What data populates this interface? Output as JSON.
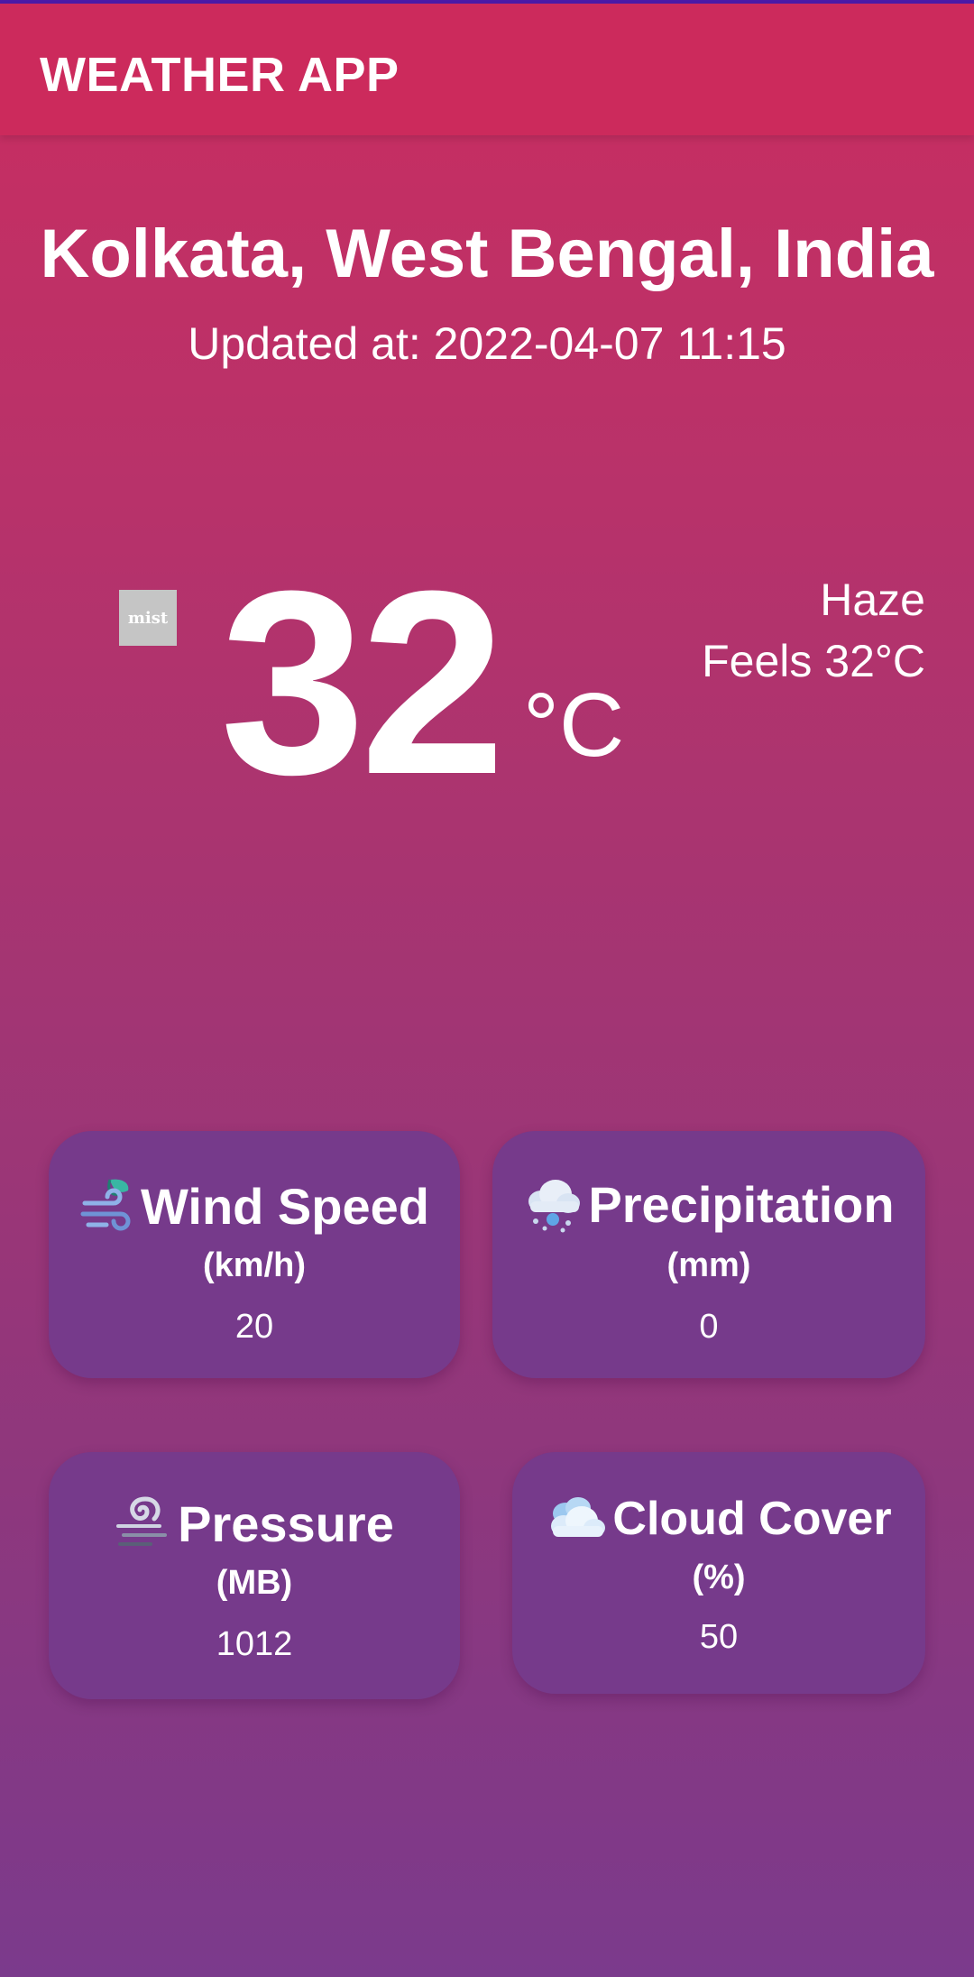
{
  "app_bar": {
    "title": "WEATHER APP"
  },
  "location": "Kolkata, West Bengal, India",
  "updated_at": "Updated at: 2022-04-07 11:15",
  "current": {
    "icon_label": "mist",
    "temperature": "32",
    "unit": "°C",
    "condition": "Haze",
    "feels_like": "Feels 32°C"
  },
  "stats": [
    {
      "title": "Wind Speed",
      "unit": "(km/h)",
      "value": "20",
      "icon": "wind-icon"
    },
    {
      "title": "Precipitation",
      "unit": "(mm)",
      "value": "0",
      "icon": "snow-cloud-icon"
    },
    {
      "title": "Pressure",
      "unit": "(MB)",
      "value": "1012",
      "icon": "pressure-icon"
    },
    {
      "title": "Cloud Cover",
      "unit": "(%)",
      "value": "50",
      "icon": "cloud-icon"
    }
  ],
  "colors": {
    "app_bar": "#cc2a5c",
    "card": "#763a8b",
    "gradient_top": "#c92d60",
    "gradient_bottom": "#7b3a8c",
    "status_strip": "#4b1aa8"
  }
}
